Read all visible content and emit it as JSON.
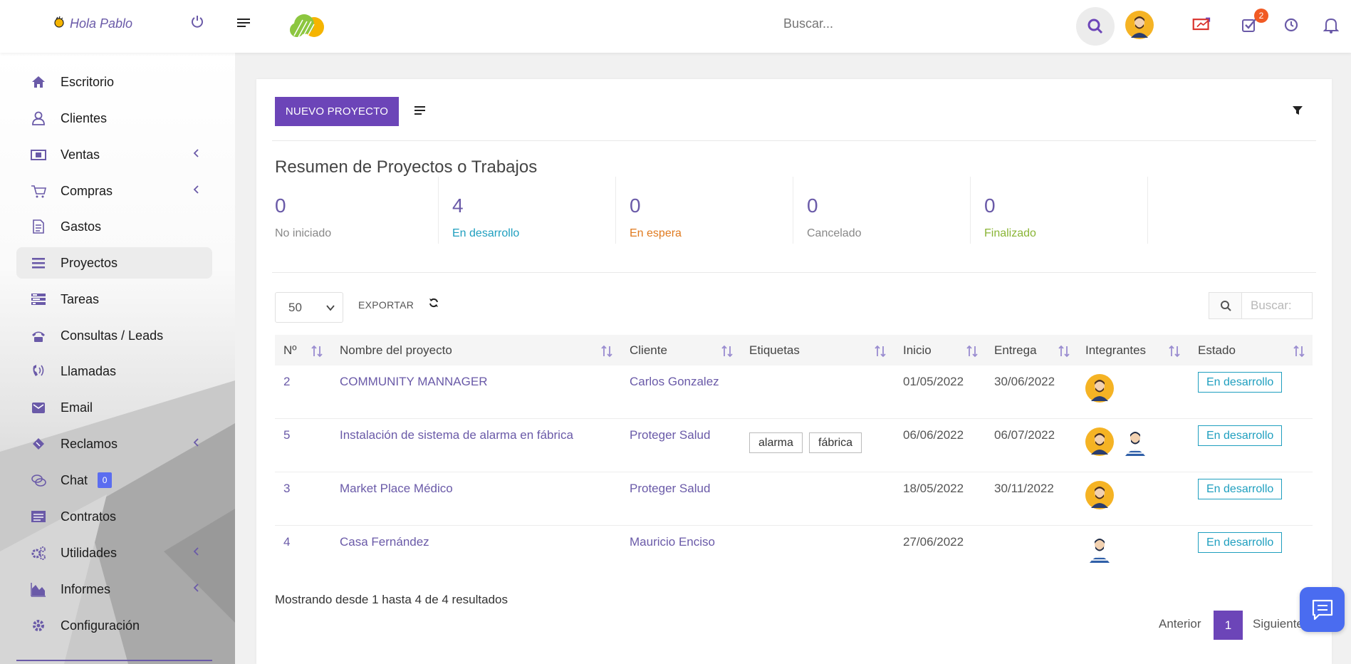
{
  "header": {
    "greeting": "Hola Pablo",
    "search_placeholder": "Buscar...",
    "tasks_badge": "2"
  },
  "sidebar": {
    "items": [
      {
        "label": "Escritorio",
        "icon": "home-icon"
      },
      {
        "label": "Clientes",
        "icon": "user-icon"
      },
      {
        "label": "Ventas",
        "icon": "money-icon",
        "submenu": true
      },
      {
        "label": "Compras",
        "icon": "cart-icon",
        "submenu": true
      },
      {
        "label": "Gastos",
        "icon": "document-icon"
      },
      {
        "label": "Proyectos",
        "icon": "bars-icon",
        "active": true
      },
      {
        "label": "Tareas",
        "icon": "tasks-icon"
      },
      {
        "label": "Consultas / Leads",
        "icon": "phone-icon"
      },
      {
        "label": "Llamadas",
        "icon": "phone-volume-icon"
      },
      {
        "label": "Email",
        "icon": "envelope-icon"
      },
      {
        "label": "Reclamos",
        "icon": "ticket-icon",
        "submenu": true
      },
      {
        "label": "Chat",
        "icon": "chat-icon",
        "badge": "0"
      },
      {
        "label": "Contratos",
        "icon": "contract-icon"
      },
      {
        "label": "Utilidades",
        "icon": "cogs-icon",
        "submenu": true
      },
      {
        "label": "Informes",
        "icon": "area-chart-icon",
        "submenu": true
      },
      {
        "label": "Configuración",
        "icon": "gear-icon"
      }
    ]
  },
  "toolbar": {
    "new_project_label": "NUEVO PROYECTO"
  },
  "summary": {
    "title": "Resumen de Proyectos o Trabajos",
    "stats": [
      {
        "value": "0",
        "label": "No iniciado",
        "color": "#888888"
      },
      {
        "value": "4",
        "label": "En desarrollo",
        "color": "#1f9fbf"
      },
      {
        "value": "0",
        "label": "En espera",
        "color": "#e07a1f"
      },
      {
        "value": "0",
        "label": "Cancelado",
        "color": "#888888"
      },
      {
        "value": "0",
        "label": "Finalizado",
        "color": "#8ab536"
      }
    ]
  },
  "table": {
    "page_size": "50",
    "export_label": "EXPORTAR",
    "search_placeholder": "Buscar:",
    "columns": [
      "Nº",
      "Nombre del proyecto",
      "Cliente",
      "Etiquetas",
      "Inicio",
      "Entrega",
      "Integrantes",
      "Estado"
    ],
    "rows": [
      {
        "id": "2",
        "name": "COMMUNITY MANNAGER",
        "client": "Carlos Gonzalez",
        "tags": [],
        "start": "01/05/2022",
        "due": "30/06/2022",
        "members": [
          "avatar-yellow"
        ],
        "status": "En desarrollo"
      },
      {
        "id": "5",
        "name": "Instalación de sistema de alarma en fábrica",
        "client": "Proteger Salud",
        "tags": [
          "alarma",
          "fábrica"
        ],
        "start": "06/06/2022",
        "due": "06/07/2022",
        "members": [
          "avatar-yellow",
          "avatar-blue"
        ],
        "status": "En desarrollo"
      },
      {
        "id": "3",
        "name": "Market Place Médico",
        "client": "Proteger Salud",
        "tags": [],
        "start": "18/05/2022",
        "due": "30/11/2022",
        "members": [
          "avatar-yellow"
        ],
        "status": "En desarrollo"
      },
      {
        "id": "4",
        "name": "Casa Fernández",
        "client": "Mauricio Enciso",
        "tags": [],
        "start": "27/06/2022",
        "due": "",
        "members": [
          "avatar-blue"
        ],
        "status": "En desarrollo"
      }
    ],
    "showing": "Mostrando desde 1 hasta 4 de 4 resultados",
    "pagination": {
      "prev": "Anterior",
      "current": "1",
      "next": "Siguiente"
    }
  },
  "colors": {
    "accent": "#6c45b8",
    "status": "#1f9fbf",
    "badge": "#f15a24",
    "chat_float": "#4a6cf0"
  }
}
